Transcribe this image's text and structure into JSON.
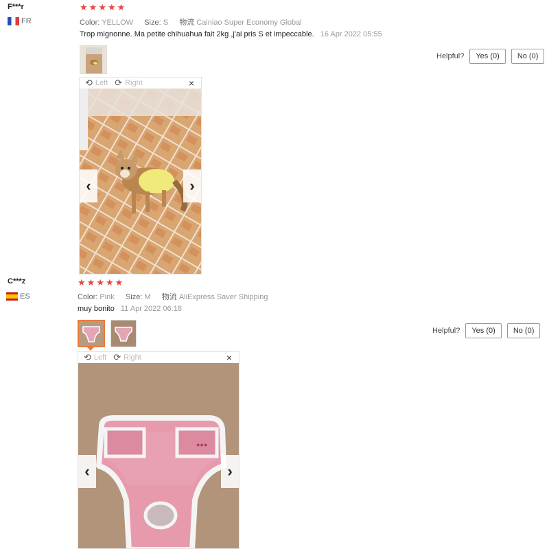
{
  "reviews": [
    {
      "user": "F***r",
      "country": "FR",
      "rating": 5,
      "color_label": "Color:",
      "color": "YELLOW",
      "size_label": "Size:",
      "size": "S",
      "shipping_label": "物流",
      "shipping": "Cainiao Super Economy Global",
      "text": "Trop mignonne. Ma petite chihuahua fait 2kg ,j'ai pris S et impeccable.",
      "date": "16 Apr 2022 05:55",
      "helpful_label": "Helpful?",
      "yes_label": "Yes (0)",
      "no_label": "No (0)"
    },
    {
      "user": "C***z",
      "country": "ES",
      "rating": 5,
      "color_label": "Color:",
      "color": "Pink",
      "size_label": "Size:",
      "size": "M",
      "shipping_label": "物流",
      "shipping": "AliExpress Saver Shipping",
      "text": "muy bonito",
      "date": "11 Apr 2022 06:18",
      "helpful_label": "Helpful?",
      "yes_label": "Yes (0)",
      "no_label": "No (0)"
    }
  ],
  "viewer": {
    "left_label": "Left",
    "right_label": "Right"
  },
  "icons": {
    "star": "★",
    "rotate_left": "⟲",
    "rotate_right": "⟳",
    "close": "×",
    "prev": "‹",
    "next": "›"
  },
  "colors": {
    "star": "#e64545",
    "thumb_active": "#e77b3b"
  }
}
